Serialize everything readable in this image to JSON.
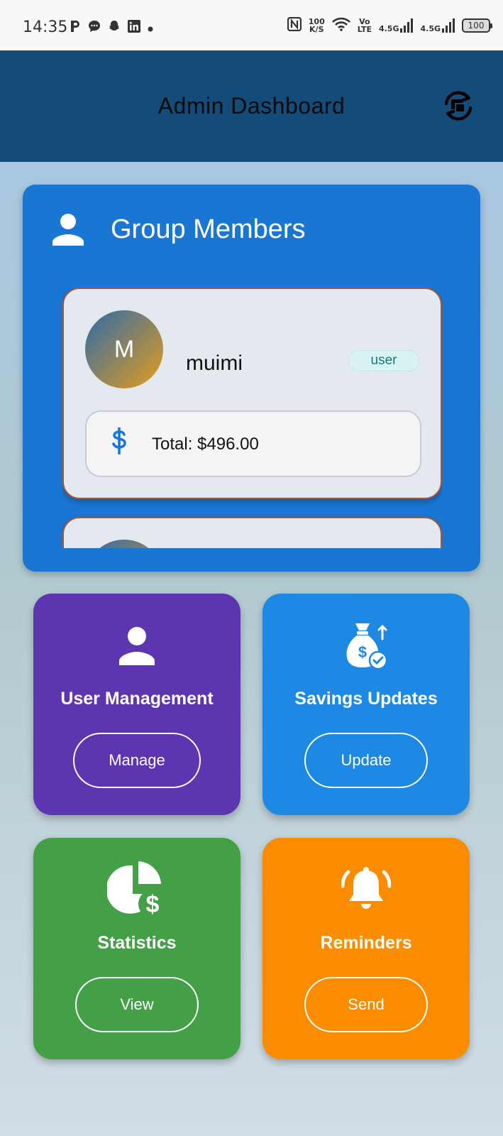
{
  "status_bar": {
    "time": "14:35",
    "speed_value": "100",
    "speed_unit": "K/S",
    "volte_top": "Vo",
    "volte_bottom": "LTE",
    "net1": "4.5G",
    "net2": "4.5G",
    "battery": "100"
  },
  "app_bar": {
    "title": "Admin Dashboard",
    "action_icon": "switch-icon"
  },
  "members": {
    "title": "Group Members",
    "items": [
      {
        "initial": "M",
        "name": "muimi",
        "role": "user",
        "total": "Total: $496.00"
      },
      {
        "initial": "",
        "name": "",
        "role": "",
        "total": ""
      }
    ]
  },
  "tiles": [
    {
      "title": "User Management",
      "button": "Manage",
      "color": "#5e35b1",
      "icon": "person-icon"
    },
    {
      "title": "Savings Updates",
      "button": "Update",
      "color": "#1e88e5",
      "icon": "money-bag-icon"
    },
    {
      "title": "Statistics",
      "button": "View",
      "color": "#43a047",
      "icon": "pie-chart-dollar-icon"
    },
    {
      "title": "Reminders",
      "button": "Send",
      "color": "#fb8c00",
      "icon": "bell-icon"
    }
  ],
  "colors": {
    "app_bar": "#134b79",
    "members_card": "#1976d2",
    "accent": "#1976d2"
  }
}
